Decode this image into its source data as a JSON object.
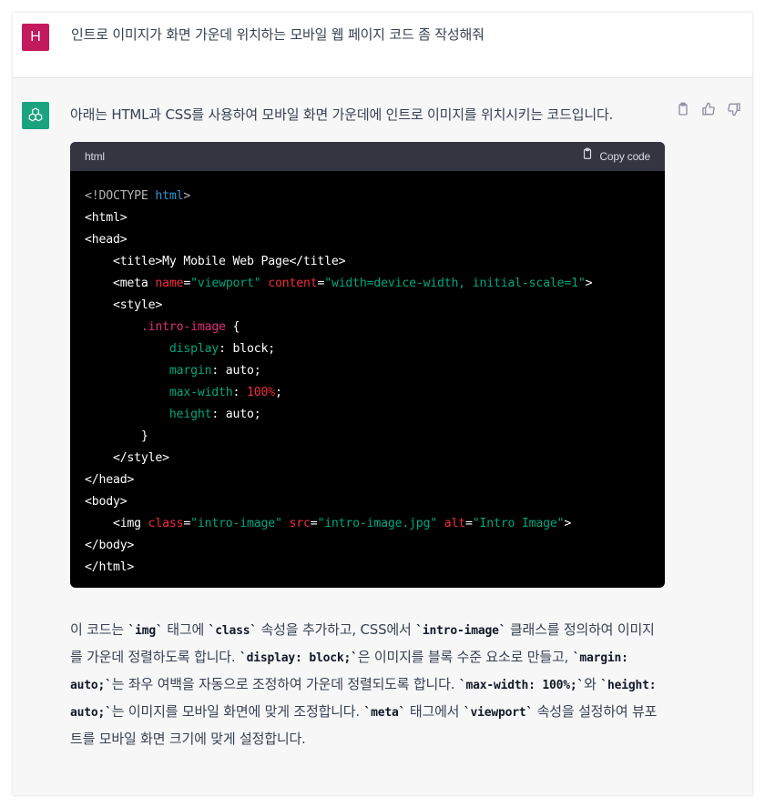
{
  "user_message": {
    "avatar_letter": "H",
    "text": "인트로 이미지가 화면 가운데 위치하는 모바일 웹 페이지 코드 좀 작성해줘"
  },
  "assistant": {
    "intro": "아래는 HTML과 CSS를 사용하여 모바일 화면 가운데에 인트로 이미지를 위치시키는 코드입니다.",
    "code_language": "html",
    "copy_label": "Copy code",
    "explanation_parts": [
      "이 코드는 ",
      "`img`",
      " 태그에 ",
      "`class`",
      " 속성을 추가하고, CSS에서 ",
      "`intro-image`",
      " 클래스를 정의하여 이미지를 가운데 정렬하도록 합니다. ",
      "`display: block;`",
      "은 이미지를 블록 수준 요소로 만들고, ",
      "`margin: auto;`",
      "는 좌우 여백을 자동으로 조정하여 가운데 정렬되도록 합니다. ",
      "`max-width: 100%;`",
      "와 ",
      "`height: auto;`",
      "는 이미지를 모바일 화면에 맞게 조정합니다. ",
      "`meta`",
      " 태그에서 ",
      "`viewport`",
      " 속성을 설정하여 뷰포트를 모바일 화면 크기에 맞게 설정합니다."
    ]
  },
  "code_tokens": [
    [
      [
        "c-gray",
        "<!DOCTYPE "
      ],
      [
        "c-blue",
        "html"
      ],
      [
        "c-gray",
        ">"
      ]
    ],
    [
      [
        "c-white",
        "<html>"
      ]
    ],
    [
      [
        "c-white",
        "<head>"
      ]
    ],
    [
      [
        "c-white",
        "    <title>My Mobile Web Page</title>"
      ]
    ],
    [
      [
        "c-white",
        "    <meta "
      ],
      [
        "c-red",
        "name"
      ],
      [
        "c-white",
        "="
      ],
      [
        "c-green",
        "\"viewport\""
      ],
      [
        "c-white",
        " "
      ],
      [
        "c-red",
        "content"
      ],
      [
        "c-white",
        "="
      ],
      [
        "c-green",
        "\"width=device-width, initial-scale=1\""
      ],
      [
        "c-white",
        ">"
      ]
    ],
    [
      [
        "c-white",
        "    <style>"
      ]
    ],
    [
      [
        "c-white",
        "        "
      ],
      [
        "c-pink",
        ".intro-image"
      ],
      [
        "c-white",
        " {"
      ]
    ],
    [
      [
        "c-white",
        "            "
      ],
      [
        "c-green",
        "display"
      ],
      [
        "c-white",
        ": block;"
      ]
    ],
    [
      [
        "c-white",
        "            "
      ],
      [
        "c-green",
        "margin"
      ],
      [
        "c-white",
        ": auto;"
      ]
    ],
    [
      [
        "c-white",
        "            "
      ],
      [
        "c-green",
        "max-width"
      ],
      [
        "c-white",
        ": "
      ],
      [
        "c-red",
        "100%"
      ],
      [
        "c-white",
        ";"
      ]
    ],
    [
      [
        "c-white",
        "            "
      ],
      [
        "c-green",
        "height"
      ],
      [
        "c-white",
        ": auto;"
      ]
    ],
    [
      [
        "c-white",
        "        }"
      ]
    ],
    [
      [
        "c-white",
        "    </style>"
      ]
    ],
    [
      [
        "c-white",
        "</head>"
      ]
    ],
    [
      [
        "c-white",
        "<body>"
      ]
    ],
    [
      [
        "c-white",
        "    <img "
      ],
      [
        "c-red",
        "class"
      ],
      [
        "c-white",
        "="
      ],
      [
        "c-green",
        "\"intro-image\""
      ],
      [
        "c-white",
        " "
      ],
      [
        "c-red",
        "src"
      ],
      [
        "c-white",
        "="
      ],
      [
        "c-green",
        "\"intro-image.jpg\""
      ],
      [
        "c-white",
        " "
      ],
      [
        "c-red",
        "alt"
      ],
      [
        "c-white",
        "="
      ],
      [
        "c-green",
        "\"Intro Image\""
      ],
      [
        "c-white",
        ">"
      ]
    ],
    [
      [
        "c-white",
        "</body>"
      ]
    ],
    [
      [
        "c-white",
        "</html>"
      ]
    ]
  ],
  "icons": [
    "openai-logo-icon",
    "clipboard-icon",
    "thumbs-up-icon",
    "thumbs-down-icon"
  ],
  "colors": {
    "user_avatar": "#c3195d",
    "bot_avatar": "#19a37f",
    "code_bg": "#000000",
    "code_header": "#343541"
  }
}
